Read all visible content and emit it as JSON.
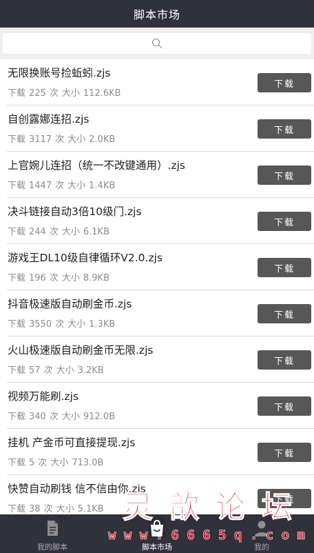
{
  "header": {
    "title": "脚本市场"
  },
  "search": {
    "icon": "search-icon"
  },
  "scripts": [
    {
      "name": "无限换账号捡蚯蚓.zjs",
      "downloads_label": "下载",
      "downloads": "225",
      "times_unit": "次",
      "size_label": "大小",
      "size": "112.6KB",
      "button": "下载"
    },
    {
      "name": "自创露娜连招.zjs",
      "downloads_label": "下载",
      "downloads": "3117",
      "times_unit": "次",
      "size_label": "大小",
      "size": "2.0KB",
      "button": "下载"
    },
    {
      "name": "上官婉儿连招（统一不改键通用）.zjs",
      "downloads_label": "下载",
      "downloads": "1447",
      "times_unit": "次",
      "size_label": "大小",
      "size": "1.4KB",
      "button": "下载"
    },
    {
      "name": "决斗链接自动3倍10级门.zjs",
      "downloads_label": "下载",
      "downloads": "244",
      "times_unit": "次",
      "size_label": "大小",
      "size": "6.1KB",
      "button": "下载"
    },
    {
      "name": "游戏王DL10级自律循环V2.0.zjs",
      "downloads_label": "下载",
      "downloads": "196",
      "times_unit": "次",
      "size_label": "大小",
      "size": "8.9KB",
      "button": "下载"
    },
    {
      "name": "抖音极速版自动刷金币.zjs",
      "downloads_label": "下载",
      "downloads": "3550",
      "times_unit": "次",
      "size_label": "大小",
      "size": "1.3KB",
      "button": "下载"
    },
    {
      "name": "火山极速版自动刷金币无限.zjs",
      "downloads_label": "下载",
      "downloads": "57",
      "times_unit": "次",
      "size_label": "大小",
      "size": "3.2KB",
      "button": "下载"
    },
    {
      "name": "视频万能刷.zjs",
      "downloads_label": "下载",
      "downloads": "340",
      "times_unit": "次",
      "size_label": "大小",
      "size": "912.0B",
      "button": "下载"
    },
    {
      "name": "挂机 产金币可直接提现.zjs",
      "downloads_label": "下载",
      "downloads": "5",
      "times_unit": "次",
      "size_label": "大小",
      "size": "713.0B",
      "button": "下载"
    },
    {
      "name": "快赞自动刷钱 信不信由你.zjs",
      "downloads_label": "下载",
      "downloads": "38",
      "times_unit": "次",
      "size_label": "大小",
      "size": "5.1KB",
      "button": "下载"
    }
  ],
  "tabs": [
    {
      "label": "我的脚本",
      "icon": "document-icon",
      "active": false
    },
    {
      "label": "脚本市场",
      "icon": "shopping-bag-icon",
      "active": true
    },
    {
      "label": "我的",
      "icon": "user-icon",
      "active": false
    }
  ],
  "watermark": {
    "title": "灵 歆 论 坛",
    "url": "w w w . 6 6 6 5 q . c o m"
  },
  "colors": {
    "header_bg": "#30313a",
    "button_bg": "#575757",
    "watermark_red": "#d4161c"
  }
}
